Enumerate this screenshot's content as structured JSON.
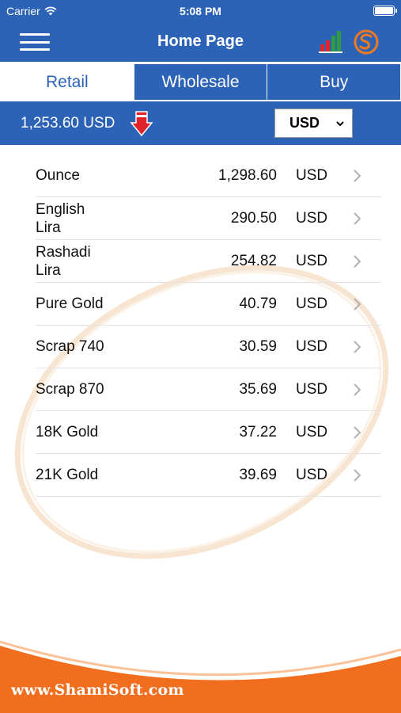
{
  "status_bar": {
    "carrier": "Carrier",
    "time": "5:08 PM"
  },
  "nav": {
    "title": "Home Page"
  },
  "tabs": [
    {
      "label": "Retail",
      "active": true
    },
    {
      "label": "Wholesale",
      "active": false
    },
    {
      "label": "Buy",
      "active": false
    }
  ],
  "summary": {
    "price_text": "1,253.60 USD",
    "currency_selected": "USD"
  },
  "prices": [
    {
      "name": "Ounce",
      "value": "1,298.60",
      "currency": "USD"
    },
    {
      "name": "English Lira",
      "value": "290.50",
      "currency": "USD"
    },
    {
      "name": "Rashadi Lira",
      "value": "254.82",
      "currency": "USD"
    },
    {
      "name": "Pure Gold",
      "value": "40.79",
      "currency": "USD"
    },
    {
      "name": "Scrap 740",
      "value": "30.59",
      "currency": "USD"
    },
    {
      "name": "Scrap 870",
      "value": "35.69",
      "currency": "USD"
    },
    {
      "name": "18K Gold",
      "value": "37.22",
      "currency": "USD"
    },
    {
      "name": "21K Gold",
      "value": "39.69",
      "currency": "USD"
    }
  ],
  "footer": {
    "website": "www.ShamiSoft.com"
  },
  "colors": {
    "brand_blue": "#2d63b7",
    "footer_orange": "#f06e1e",
    "trend_down_red": "#e0242b",
    "chart_green": "#2e9d3a",
    "logo_orange": "#f07a21"
  },
  "icons": [
    "menu-icon",
    "chart-icon",
    "shamisoft-logo-icon",
    "down-arrow-icon",
    "chevron-right-icon",
    "wifi-icon",
    "battery-icon"
  ]
}
